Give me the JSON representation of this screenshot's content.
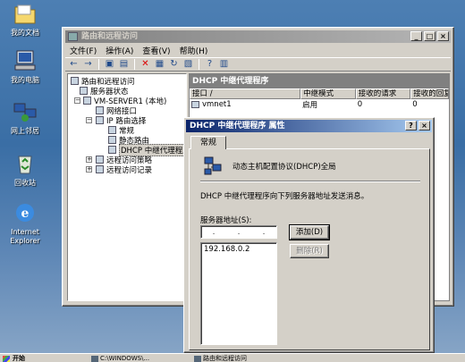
{
  "desktop": {
    "icons": [
      {
        "label": "我的文档",
        "icon": "folder-icon"
      },
      {
        "label": "我的电脑",
        "icon": "computer-icon"
      },
      {
        "label": "网上邻居",
        "icon": "network-icon"
      },
      {
        "label": "回收站",
        "icon": "recycle-bin-icon"
      },
      {
        "label": "Internet Explorer",
        "icon": "ie-icon"
      }
    ]
  },
  "main_window": {
    "title": "路由和远程访问",
    "menu": [
      "文件(F)",
      "操作(A)",
      "查看(V)",
      "帮助(H)"
    ],
    "title_buttons": [
      "_",
      "□",
      "×"
    ]
  },
  "tree": {
    "items": [
      {
        "label": "路由和远程访问"
      },
      {
        "label": "服务器状态"
      },
      {
        "label": "VM-SERVER1 (本地)"
      },
      {
        "label": "网络接口"
      },
      {
        "label": "IP 路由选择"
      },
      {
        "label": "常规"
      },
      {
        "label": "静态路由"
      },
      {
        "label": "DHCP 中继代理程序"
      },
      {
        "label": "远程访问策略"
      },
      {
        "label": "远程访问记录"
      }
    ]
  },
  "right_panel": {
    "header": "DHCP 中继代理程序",
    "columns": [
      "接口 /",
      "中继模式",
      "接收的请求",
      "接收的回复"
    ],
    "rows": [
      {
        "iface": "vmnet1",
        "mode": "启用",
        "requests": "0",
        "replies": "0"
      }
    ]
  },
  "dialog": {
    "title": "DHCP 中继代理程序 属性",
    "title_buttons": [
      "?",
      "×"
    ],
    "tab": "常规",
    "protocol": "动态主机配置协议(DHCP)全局",
    "description": "DHCP 中继代理程序向下列服务器地址发送消息。",
    "server_label": "服务器地址(S):",
    "ip_input": {
      "dots": [
        ".",
        ".",
        "."
      ]
    },
    "add_button": "添加(D)",
    "remove_button": "删除(R)",
    "servers": [
      "192.168.0.2"
    ]
  },
  "taskbar": {
    "start": "开始",
    "items": [
      "C:\\WINDOWS\\...",
      "路由和远程访问"
    ]
  }
}
